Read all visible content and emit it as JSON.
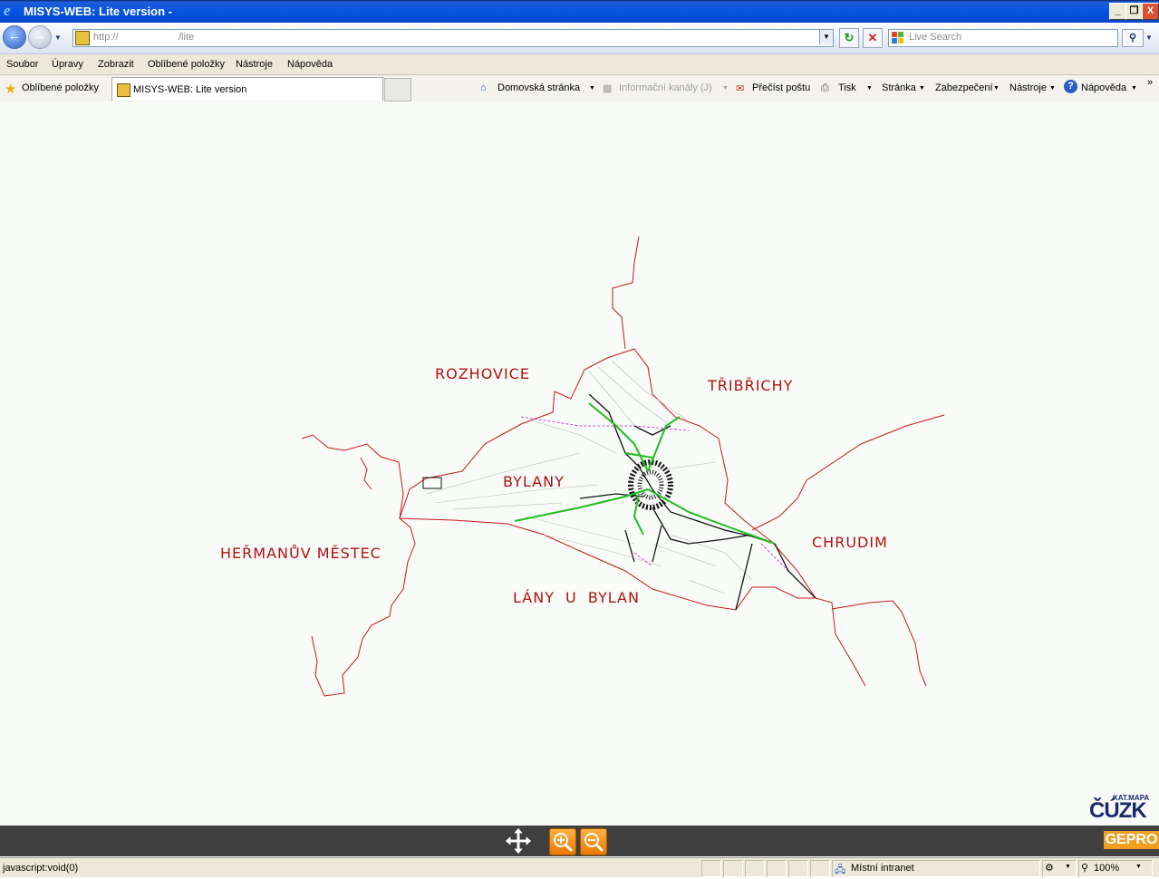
{
  "window": {
    "title": "MISYS-WEB: Lite version -"
  },
  "window_controls": {
    "minimize": "_",
    "maximize": "❐",
    "close": "X"
  },
  "address": {
    "protocol": "http://",
    "path": "/lite"
  },
  "search": {
    "placeholder": "Live Search"
  },
  "menu": [
    "Soubor",
    "Úpravy",
    "Zobrazit",
    "Oblíbené položky",
    "Nástroje",
    "Nápověda"
  ],
  "favorites": {
    "label": "Oblíbené položky",
    "tab_title": "MISYS-WEB: Lite version"
  },
  "command_bar": {
    "home": "Domovská stránka",
    "feeds": "Informační kanály (J)",
    "mail": "Přečíst poštu",
    "print": "Tisk",
    "page": "Stránka",
    "safety": "Zabezpečení",
    "tools": "Nástroje",
    "help": "Nápověda"
  },
  "map": {
    "labels": {
      "rozhovice": "ROZHOVICE",
      "tribrichy": "TŘIBŘICHY",
      "bylany": "BYLANY",
      "hermanuv_mestec": "HEŘMANŮV MĚSTEC",
      "chrudim": "CHRUDIM",
      "lany_u_bylan": "LÁNY U BYLAN"
    },
    "colors": {
      "boundary": "#c81818",
      "network_green": "#1fbf1f",
      "network_black": "#111111",
      "label": "#b01010"
    }
  },
  "logo": {
    "top_text": "KAT.MAPA",
    "name": "ČÚZK"
  },
  "brand": "GEPRO",
  "status": {
    "text": "javascript:void(0)",
    "zone": "Místní intranet",
    "zoom": "100%"
  }
}
